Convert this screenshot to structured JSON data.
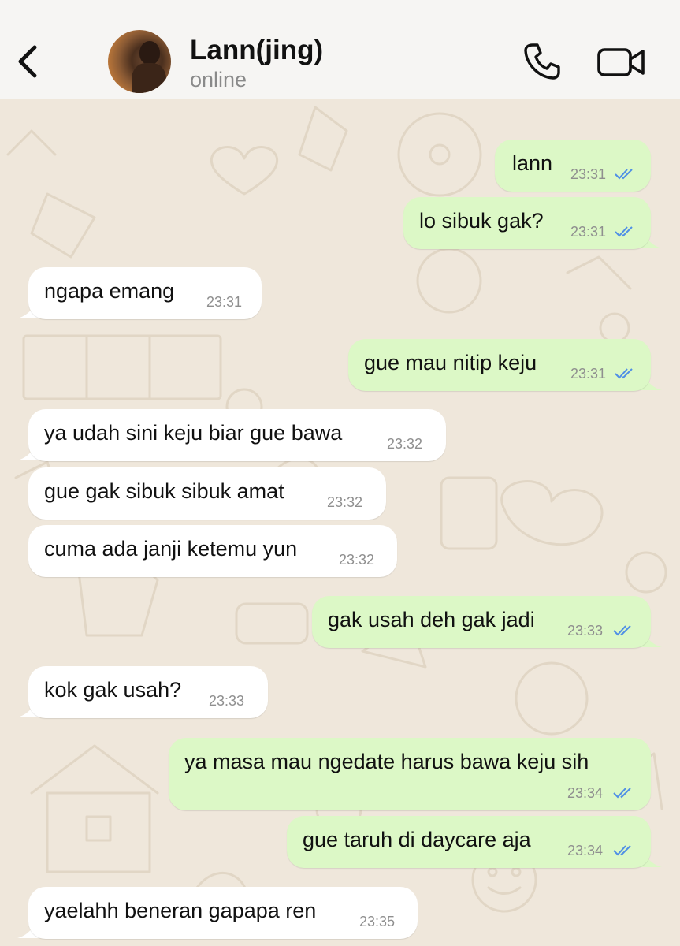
{
  "header": {
    "contact_name": "Lann(jing)",
    "status": "online",
    "back_icon": "chevron-left-icon",
    "call_icon": "phone-icon",
    "video_icon": "video-camera-icon"
  },
  "colors": {
    "outgoing_bubble": "#dcf8c6",
    "incoming_bubble": "#ffffff",
    "wallpaper": "#efe7db",
    "read_ticks": "#4f8fe6",
    "header_bg": "#f6f5f3"
  },
  "messages": [
    {
      "direction": "out",
      "text": "lann",
      "time": "23:31",
      "status": "read"
    },
    {
      "direction": "out",
      "text": "lo sibuk gak?",
      "time": "23:31",
      "status": "read"
    },
    {
      "direction": "in",
      "text": "ngapa emang",
      "time": "23:31"
    },
    {
      "direction": "out",
      "text": "gue mau nitip keju",
      "time": "23:31",
      "status": "read"
    },
    {
      "direction": "in",
      "text": "ya udah sini keju biar gue bawa",
      "time": "23:32"
    },
    {
      "direction": "in",
      "text": "gue gak sibuk sibuk amat",
      "time": "23:32"
    },
    {
      "direction": "in",
      "text": "cuma ada janji ketemu yun",
      "time": "23:32"
    },
    {
      "direction": "out",
      "text": "gak usah deh gak jadi",
      "time": "23:33",
      "status": "read"
    },
    {
      "direction": "in",
      "text": "kok gak usah?",
      "time": "23:33"
    },
    {
      "direction": "out",
      "text": "ya masa mau ngedate harus bawa keju sih",
      "time": "23:34",
      "status": "read"
    },
    {
      "direction": "out",
      "text": "gue taruh di daycare aja",
      "time": "23:34",
      "status": "read"
    },
    {
      "direction": "in",
      "text": "yaelahh beneran gapapa ren",
      "time": "23:35"
    }
  ]
}
